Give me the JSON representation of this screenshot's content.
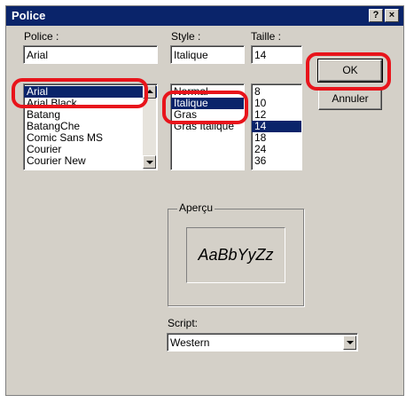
{
  "window": {
    "title": "Police",
    "help_glyph": "?",
    "close_glyph": "×"
  },
  "font": {
    "label": "Police :",
    "value": "Arial",
    "items": [
      "Arial",
      "Arial Black",
      "Batang",
      "BatangChe",
      "Comic Sans MS",
      "Courier",
      "Courier New"
    ],
    "selected": "Arial"
  },
  "style": {
    "label": "Style :",
    "value": "Italique",
    "items": [
      "Normal",
      "Italique",
      "Gras",
      "Gras Italique"
    ],
    "selected": "Italique"
  },
  "size": {
    "label": "Taille :",
    "value": "14",
    "items": [
      "8",
      "10",
      "12",
      "14",
      "18",
      "24",
      "36"
    ],
    "selected": "14"
  },
  "buttons": {
    "ok": "OK",
    "cancel": "Annuler"
  },
  "preview": {
    "label": "Aperçu",
    "sample": "AaBbYyZz"
  },
  "script": {
    "label": "Script:",
    "value": "Western"
  },
  "colors": {
    "selection": "#0a246a",
    "highlight_circle": "#e8141b",
    "dialog_bg": "#d4d0c8"
  }
}
